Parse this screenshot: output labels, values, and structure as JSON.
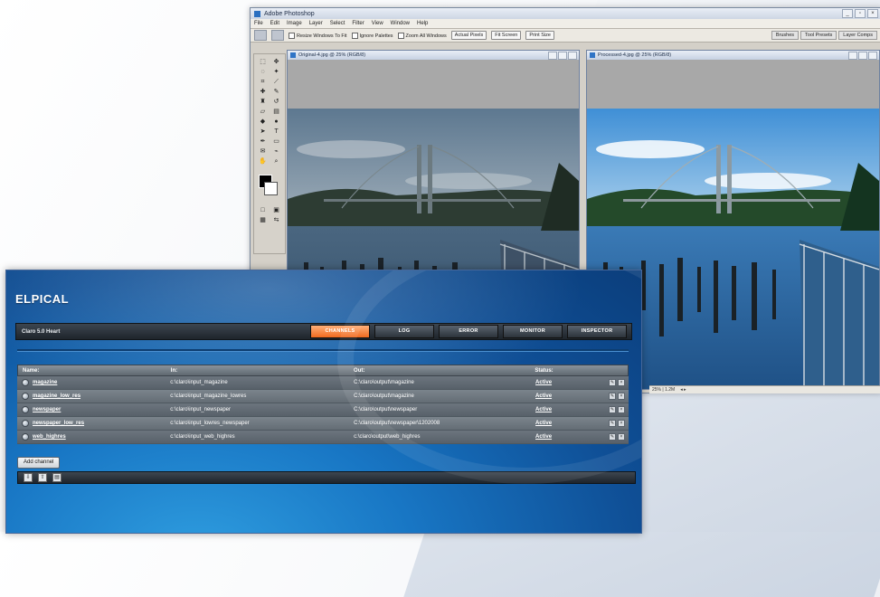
{
  "photoshop": {
    "title": "Adobe Photoshop",
    "menu": [
      "File",
      "Edit",
      "Image",
      "Layer",
      "Select",
      "Filter",
      "View",
      "Window",
      "Help"
    ],
    "options": {
      "resize_label": "Resize Windows To Fit",
      "ignore_palettes_label": "Ignore Palettes",
      "zoom_all_label": "Zoom All Windows",
      "actual_pixels": "Actual Pixels",
      "fit_screen": "Fit Screen",
      "print_size": "Print Size"
    },
    "palette_tabs": [
      "Brushes",
      "Tool Presets",
      "Layer Comps"
    ],
    "doc_left_title": "Original-4.jpg @ 25% (RGB/8)",
    "doc_right_title": "Processed-4.jpg @ 25% (RGB/8)",
    "status": "25% | 1.2M"
  },
  "claro": {
    "logo": "ELPICAL",
    "app_title": "Claro 5.0 Heart",
    "tabs": [
      "CHANNELS",
      "LOG",
      "ERROR",
      "MONITOR",
      "INSPECTOR"
    ],
    "columns": {
      "name": "Name:",
      "in": "In:",
      "out": "Out:",
      "status": "Status:"
    },
    "rows": [
      {
        "name": "magazine",
        "in": "c:\\claro\\input_magazine",
        "out": "C:\\claro\\output\\magazine",
        "status": "Active"
      },
      {
        "name": "magazine_low_res",
        "in": "c:\\claro\\input_magazine_lowres",
        "out": "C:\\claro\\output\\magazine",
        "status": "Active"
      },
      {
        "name": "newspaper",
        "in": "c:\\claro\\input_newspaper",
        "out": "C:\\claro\\output\\newspaper",
        "status": "Active"
      },
      {
        "name": "newspaper_low_res",
        "in": "c:\\claro\\input_lowres_newspaper",
        "out": "C:\\claro\\output\\newspaper\\1202008",
        "status": "Active"
      },
      {
        "name": "web_highres",
        "in": "c:\\claro\\input_web_highres",
        "out": "c:\\claro\\output\\web_highres",
        "status": "Active"
      }
    ],
    "add_channel": "Add channel"
  }
}
